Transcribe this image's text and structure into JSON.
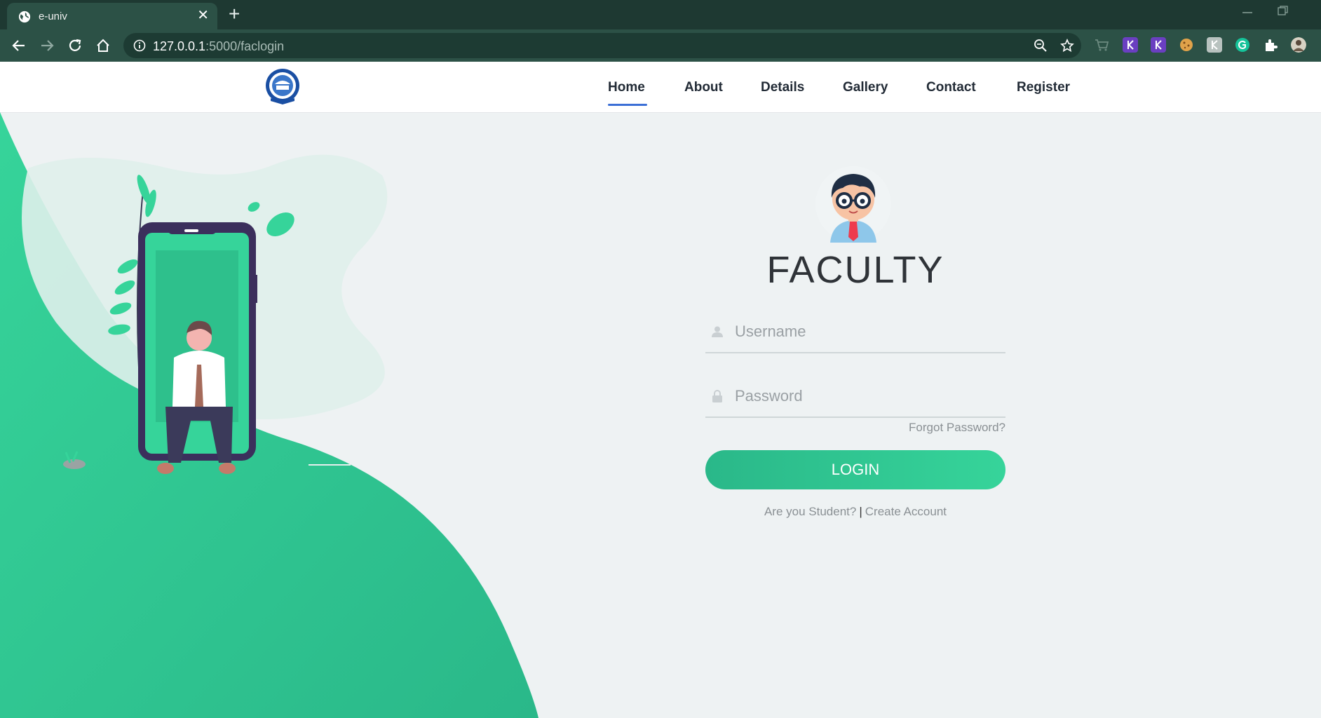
{
  "browser": {
    "tab_title": "e-univ",
    "tab_close": "✕",
    "new_tab": "+",
    "url_host": "127.0.0.1",
    "url_rest": ":5000/faclogin"
  },
  "site": {
    "nav": {
      "home": "Home",
      "about": "About",
      "details": "Details",
      "gallery": "Gallery",
      "contact": "Contact",
      "register": "Register"
    },
    "active_nav": "Home",
    "accent_color": "#2ec98e",
    "nav_underline_color": "#3b6fd6"
  },
  "login": {
    "title": "FACULTY",
    "username_placeholder": "Username",
    "password_placeholder": "Password",
    "forgot_label": "Forgot Password?",
    "login_label": "LOGIN",
    "student_prompt": "Are you Student?",
    "separator": "|",
    "create_account": "Create Account"
  },
  "icons": [
    "globe-icon",
    "back-icon",
    "forward-icon",
    "reload-icon",
    "home-icon",
    "info-icon",
    "zoom-icon",
    "star-icon",
    "cart-icon",
    "extension-icon",
    "avatar-icon",
    "user-icon",
    "lock-icon"
  ]
}
